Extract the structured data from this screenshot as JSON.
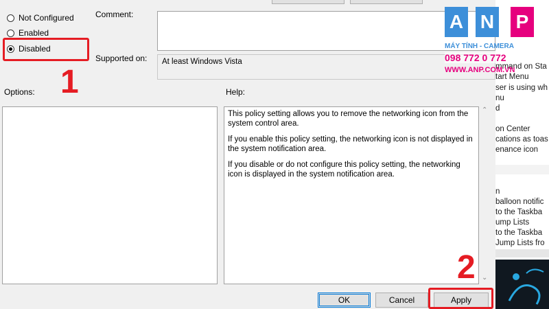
{
  "policy": {
    "options": [
      {
        "label": "Not Configured",
        "checked": false
      },
      {
        "label": "Enabled",
        "checked": false
      },
      {
        "label": "Disabled",
        "checked": true
      }
    ],
    "comment_label": "Comment:",
    "comment_value": "",
    "supported_label": "Supported on:",
    "supported_value": "At least Windows Vista",
    "options_label": "Options:",
    "help_label": "Help:",
    "help_paragraphs": [
      "This policy setting allows you to remove the networking icon from the system control area.",
      "If you enable this policy setting, the networking icon is not displayed in the system notification area.",
      "If you disable or do not configure this policy setting, the networking icon is displayed in the system notification area."
    ]
  },
  "buttons": {
    "ok": "OK",
    "cancel": "Cancel",
    "apply": "Apply"
  },
  "annotations": {
    "step1": "1",
    "step2": "2",
    "color": "#e51c23"
  },
  "background_window": {
    "items": [
      "mmand on Sta",
      "tart Menu",
      "ser is using wh",
      "nu",
      "d",
      "on Center",
      "cations as toas",
      "enance icon",
      "n",
      "balloon notific",
      "to the Taskba",
      "ump Lists",
      "to the Taskba",
      "Jump Lists fro"
    ]
  },
  "watermark": {
    "letters": [
      "A",
      "N",
      "P"
    ],
    "tagline": "MÁY TÍNH - CAMERA",
    "phone": "098 772 0 772",
    "website": "WWW.ANP.COM.VN",
    "colors": {
      "blue": "#3d8fd9",
      "pink": "#e6007e"
    }
  }
}
